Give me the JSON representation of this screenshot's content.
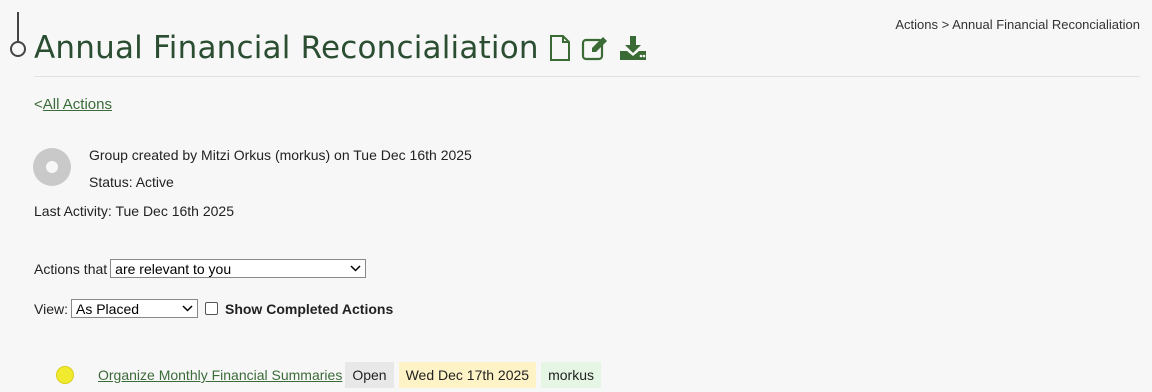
{
  "breadcrumb": {
    "root": "Actions",
    "separator": ">",
    "current": "Annual Financial Reconcialiation"
  },
  "header": {
    "title": "Annual Financial Reconcialiation",
    "icons": [
      "document-icon",
      "edit-icon",
      "download-icon"
    ],
    "title_color": "#2b4e32"
  },
  "back": {
    "prefix": "<",
    "label": "All Actions"
  },
  "group": {
    "created_text": "Group created by Mitzi Orkus (morkus) on Tue Dec 16th 2025",
    "status_text": "Status: Active",
    "last_activity": "Last Activity: Tue Dec 16th 2025"
  },
  "filters": {
    "actions_label": "Actions that",
    "actions_selected": "are relevant to you",
    "view_label": "View:",
    "view_selected": "As Placed",
    "show_completed_label": "Show Completed Actions",
    "show_completed_checked": false
  },
  "actions": [
    {
      "title": "Organize Monthly Financial Summaries",
      "status": "Open",
      "due": "Wed Dec 17th 2025",
      "user": "morkus",
      "status_color": "#f2ea2e"
    }
  ]
}
